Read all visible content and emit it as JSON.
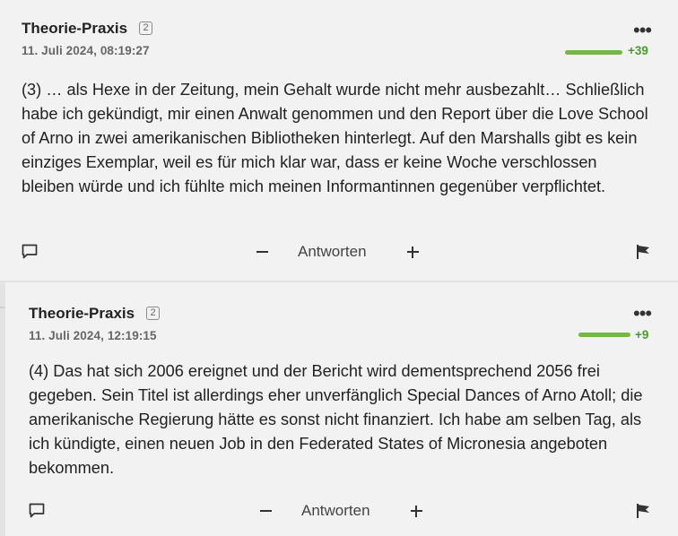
{
  "comments": [
    {
      "author": "Theorie-Praxis",
      "badge": "2",
      "date": "11. Juli 2024, 08:19:27",
      "votes": "+39",
      "vote_fill": 1.0,
      "text": "(3) … als Hexe in der Zeitung, mein Gehalt wurde nicht mehr ausbezahlt… Schließlich habe ich gekündigt, mir einen Anwalt genommen und den Report über die Love School of Arno in zwei amerikanischen Bibliotheken hinterlegt. Auf den Marshalls gibt es kein einziges Exemplar, weil es für mich klar war, dass er keine Woche verschlossen bleiben würde und ich fühlte mich meinen Informantinnen gegenüber verpflichtet.",
      "reply_label": "Antworten"
    },
    {
      "author": "Theorie-Praxis",
      "badge": "2",
      "date": "11. Juli 2024, 12:19:15",
      "votes": "+9",
      "vote_fill": 1.0,
      "text": "(4) Das hat sich 2006 ereignet und der Bericht wird dementsprechend 2056 frei gegeben. Sein Titel ist allerdings eher unverfänglich Special Dances of Arno Atoll; die amerikanische Regierung hätte es sonst nicht finanziert. Ich habe am selben Tag, als ich kündigte, einen neuen Job in den Federated States of Micronesia angeboten bekommen.",
      "reply_label": "Antworten"
    }
  ],
  "icons": {
    "more": "more-options-icon",
    "comment": "comment-icon",
    "minus": "minus-icon",
    "plus": "plus-icon",
    "flag": "flag-icon"
  },
  "colors": {
    "background": "#f2f2f2",
    "vote_bar": "#74b844",
    "vote_text": "#4c9a2a"
  }
}
